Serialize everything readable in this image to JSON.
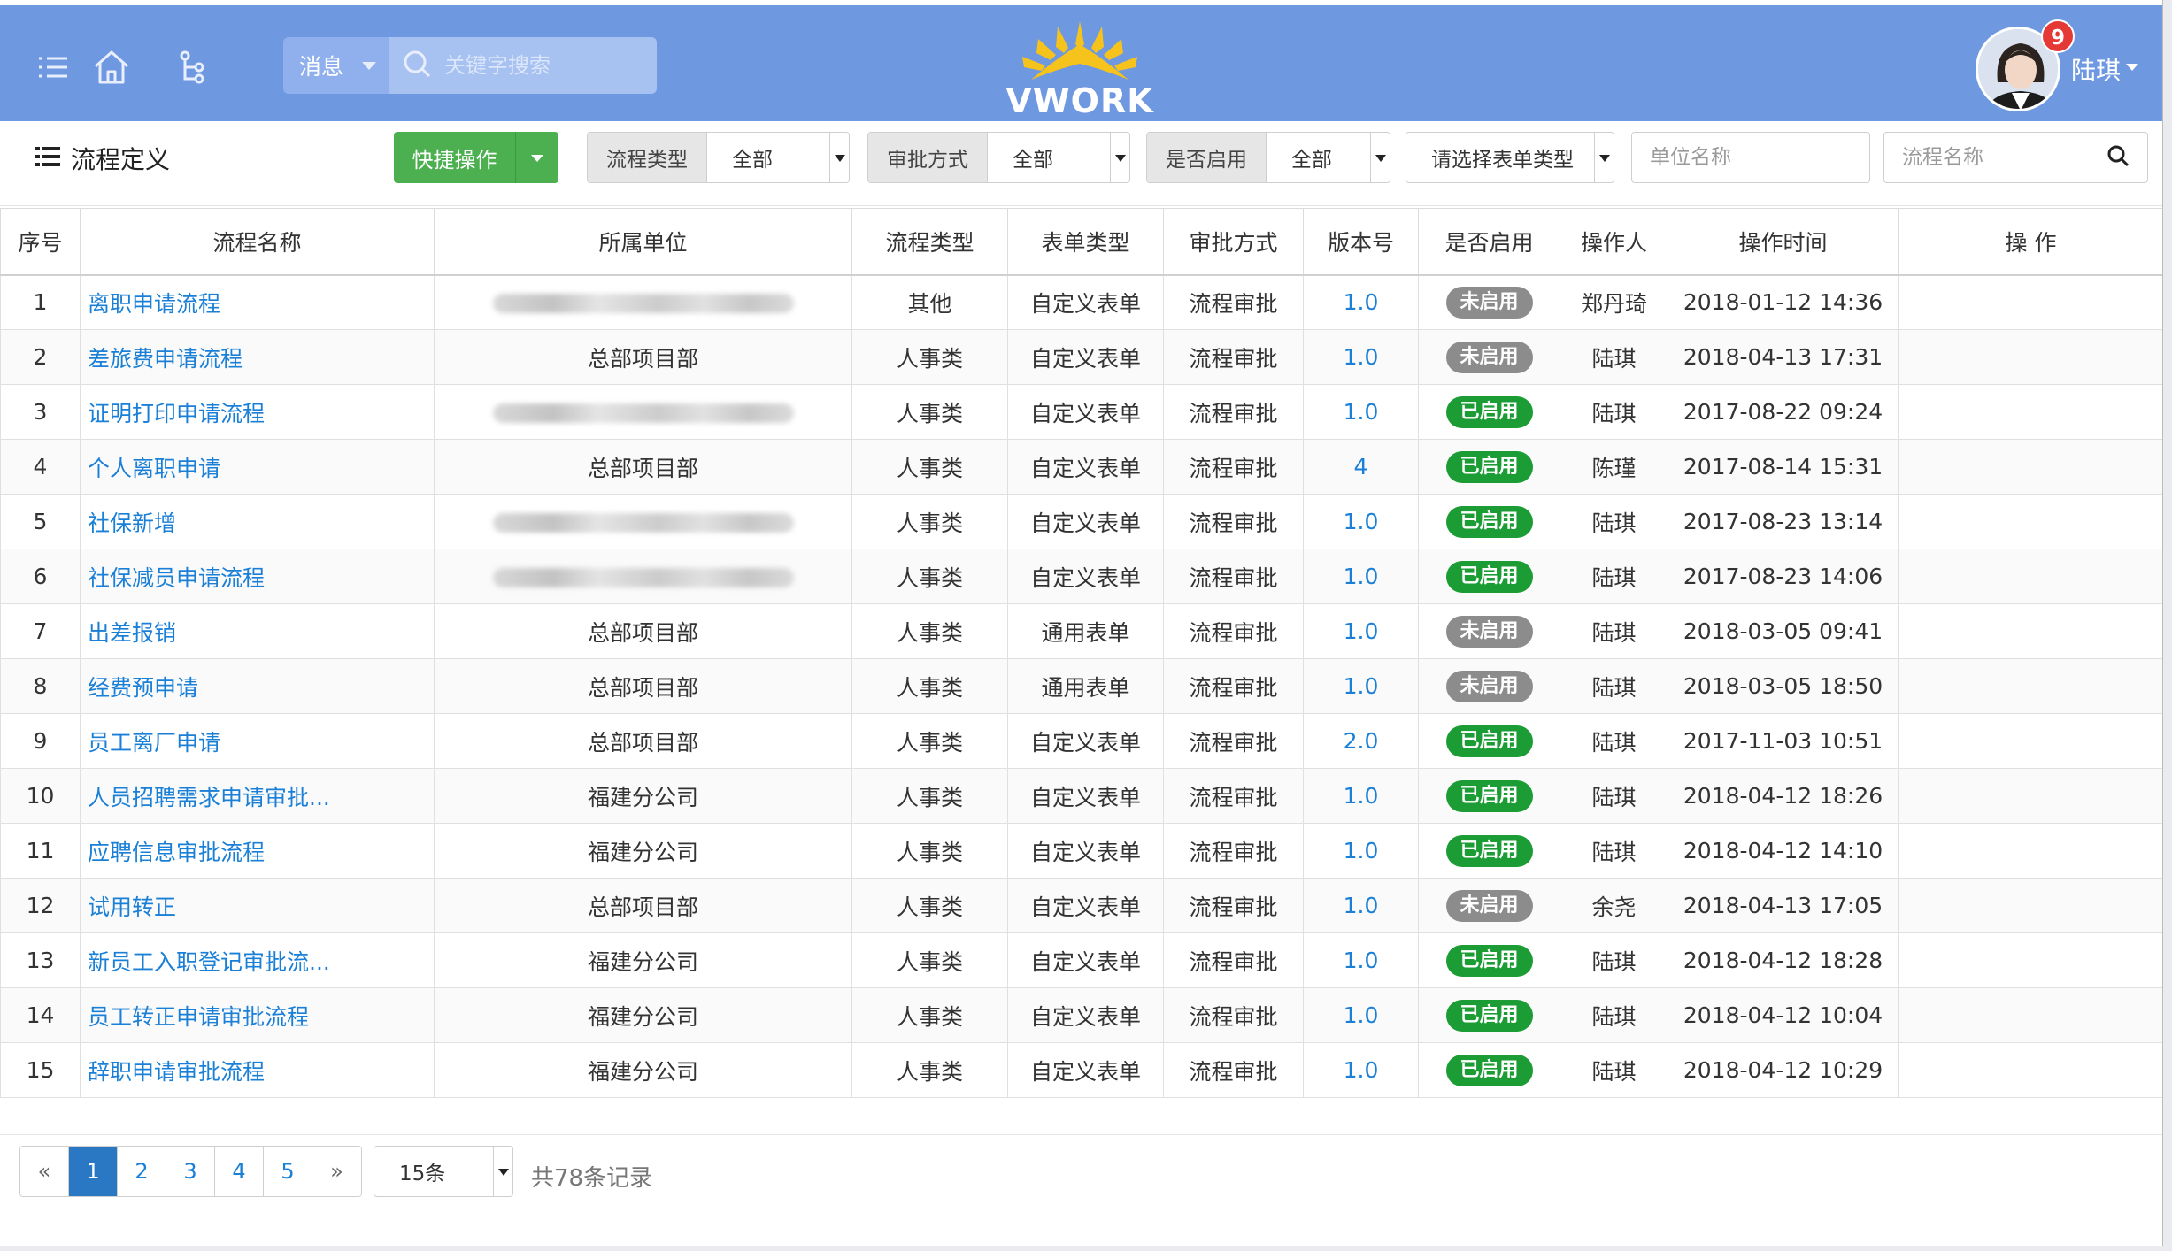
{
  "header": {
    "message_select": "消息",
    "search_placeholder": "关键字搜索",
    "logo_text": "VWORK",
    "user_name": "陆琪",
    "notification_count": "9",
    "icons": [
      "list-icon",
      "home-icon",
      "org-tree-icon",
      "search-icon"
    ]
  },
  "toolbar": {
    "page_title": "流程定义",
    "quick_action_label": "快捷操作",
    "filters": [
      {
        "label": "流程类型",
        "value": "全部"
      },
      {
        "label": "审批方式",
        "value": "全部"
      },
      {
        "label": "是否启用",
        "value": "全部"
      }
    ],
    "form_type_select": "请选择表单类型",
    "unit_name_placeholder": "单位名称",
    "process_name_placeholder": "流程名称"
  },
  "table": {
    "columns": [
      "序号",
      "流程名称",
      "所属单位",
      "流程类型",
      "表单类型",
      "审批方式",
      "版本号",
      "是否启用",
      "操作人",
      "操作时间",
      "操 作"
    ],
    "rows": [
      {
        "no": "1",
        "name": "离职申请流程",
        "unit": "",
        "unit_blurred": true,
        "type": "其他",
        "form": "自定义表单",
        "approval": "流程审批",
        "version": "1.0",
        "status": "未启用",
        "enabled": false,
        "operator": "郑丹琦",
        "time": "2018-01-12 14:36"
      },
      {
        "no": "2",
        "name": "差旅费申请流程",
        "unit": "总部项目部",
        "unit_blurred": false,
        "type": "人事类",
        "form": "自定义表单",
        "approval": "流程审批",
        "version": "1.0",
        "status": "未启用",
        "enabled": false,
        "operator": "陆琪",
        "time": "2018-04-13 17:31"
      },
      {
        "no": "3",
        "name": "证明打印申请流程",
        "unit": "",
        "unit_blurred": true,
        "type": "人事类",
        "form": "自定义表单",
        "approval": "流程审批",
        "version": "1.0",
        "status": "已启用",
        "enabled": true,
        "operator": "陆琪",
        "time": "2017-08-22 09:24"
      },
      {
        "no": "4",
        "name": "个人离职申请",
        "unit": "总部项目部",
        "unit_blurred": false,
        "type": "人事类",
        "form": "自定义表单",
        "approval": "流程审批",
        "version": "4",
        "status": "已启用",
        "enabled": true,
        "operator": "陈瑾",
        "time": "2017-08-14 15:31"
      },
      {
        "no": "5",
        "name": "社保新增",
        "unit": "",
        "unit_blurred": true,
        "type": "人事类",
        "form": "自定义表单",
        "approval": "流程审批",
        "version": "1.0",
        "status": "已启用",
        "enabled": true,
        "operator": "陆琪",
        "time": "2017-08-23 13:14"
      },
      {
        "no": "6",
        "name": "社保减员申请流程",
        "unit": "",
        "unit_blurred": true,
        "type": "人事类",
        "form": "自定义表单",
        "approval": "流程审批",
        "version": "1.0",
        "status": "已启用",
        "enabled": true,
        "operator": "陆琪",
        "time": "2017-08-23 14:06"
      },
      {
        "no": "7",
        "name": "出差报销",
        "unit": "总部项目部",
        "unit_blurred": false,
        "type": "人事类",
        "form": "通用表单",
        "approval": "流程审批",
        "version": "1.0",
        "status": "未启用",
        "enabled": false,
        "operator": "陆琪",
        "time": "2018-03-05 09:41"
      },
      {
        "no": "8",
        "name": "经费预申请",
        "unit": "总部项目部",
        "unit_blurred": false,
        "type": "人事类",
        "form": "通用表单",
        "approval": "流程审批",
        "version": "1.0",
        "status": "未启用",
        "enabled": false,
        "operator": "陆琪",
        "time": "2018-03-05 18:50"
      },
      {
        "no": "9",
        "name": "员工离厂申请",
        "unit": "总部项目部",
        "unit_blurred": false,
        "type": "人事类",
        "form": "自定义表单",
        "approval": "流程审批",
        "version": "2.0",
        "status": "已启用",
        "enabled": true,
        "operator": "陆琪",
        "time": "2017-11-03 10:51"
      },
      {
        "no": "10",
        "name": "人员招聘需求申请审批...",
        "unit": "福建分公司",
        "unit_blurred": false,
        "type": "人事类",
        "form": "自定义表单",
        "approval": "流程审批",
        "version": "1.0",
        "status": "已启用",
        "enabled": true,
        "operator": "陆琪",
        "time": "2018-04-12 18:26"
      },
      {
        "no": "11",
        "name": "应聘信息审批流程",
        "unit": "福建分公司",
        "unit_blurred": false,
        "type": "人事类",
        "form": "自定义表单",
        "approval": "流程审批",
        "version": "1.0",
        "status": "已启用",
        "enabled": true,
        "operator": "陆琪",
        "time": "2018-04-12 14:10"
      },
      {
        "no": "12",
        "name": "试用转正",
        "unit": "总部项目部",
        "unit_blurred": false,
        "type": "人事类",
        "form": "自定义表单",
        "approval": "流程审批",
        "version": "1.0",
        "status": "未启用",
        "enabled": false,
        "operator": "余尧",
        "time": "2018-04-13 17:05"
      },
      {
        "no": "13",
        "name": "新员工入职登记审批流...",
        "unit": "福建分公司",
        "unit_blurred": false,
        "type": "人事类",
        "form": "自定义表单",
        "approval": "流程审批",
        "version": "1.0",
        "status": "已启用",
        "enabled": true,
        "operator": "陆琪",
        "time": "2018-04-12 18:28"
      },
      {
        "no": "14",
        "name": "员工转正申请审批流程",
        "unit": "福建分公司",
        "unit_blurred": false,
        "type": "人事类",
        "form": "自定义表单",
        "approval": "流程审批",
        "version": "1.0",
        "status": "已启用",
        "enabled": true,
        "operator": "陆琪",
        "time": "2018-04-12 10:04"
      },
      {
        "no": "15",
        "name": "辞职申请审批流程",
        "unit": "福建分公司",
        "unit_blurred": false,
        "type": "人事类",
        "form": "自定义表单",
        "approval": "流程审批",
        "version": "1.0",
        "status": "已启用",
        "enabled": true,
        "operator": "陆琪",
        "time": "2018-04-12 10:29"
      }
    ]
  },
  "pagination": {
    "prev": "«",
    "pages": [
      "1",
      "2",
      "3",
      "4",
      "5"
    ],
    "current": "1",
    "next": "»",
    "page_size": "15条",
    "total_text": "共78条记录"
  },
  "colors": {
    "header_bg": "#6e98e0",
    "quick_action": "#4caf50",
    "link": "#1a7fd6",
    "enabled_badge": "#1b9c34",
    "disabled_badge": "#8c8c8c",
    "notification": "#e53935"
  }
}
